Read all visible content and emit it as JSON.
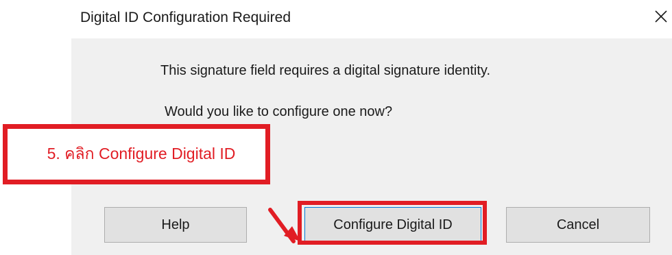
{
  "dialog": {
    "title": "Digital ID Configuration Required",
    "close_icon": "close-icon",
    "message_line_1": "This signature field requires a digital signature identity.",
    "message_line_2": "Would you like to configure one now?",
    "buttons": {
      "help": "Help",
      "configure": "Configure Digital ID",
      "cancel": "Cancel"
    }
  },
  "annotation": {
    "callout_text": "5. คลิก Configure Digital ID",
    "accent_color": "#e11d24",
    "arrow_icon": "arrow-down-right-icon"
  }
}
